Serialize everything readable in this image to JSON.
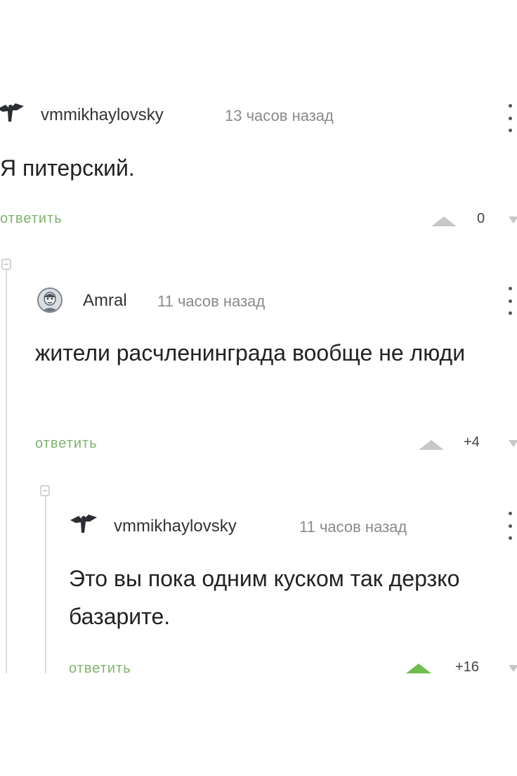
{
  "comments": [
    {
      "username": "vmmikhaylovsky",
      "time": "13 часов назад",
      "text": "Я питерский.",
      "reply_label": "ответить",
      "rating": "0",
      "avatar": "bird-avatar-icon"
    },
    {
      "username": "Amral",
      "time": "11 часов назад",
      "text": "жители расчленинграда вообще не люди",
      "reply_label": "ответить",
      "rating": "+4",
      "avatar": "face-avatar-icon"
    },
    {
      "username": "vmmikhaylovsky",
      "time": "11 часов назад",
      "text": "Это вы пока одним куском так дерзко базарите.",
      "reply_label": "ответить",
      "rating": "+16",
      "avatar": "bird-avatar-icon",
      "upvoted": true
    }
  ],
  "colors": {
    "reply_green": "#7eb36e",
    "upvote_active": "#6dbd4f",
    "upvote_inactive": "#c7c7c7",
    "meta_gray": "#8a8a8a"
  }
}
